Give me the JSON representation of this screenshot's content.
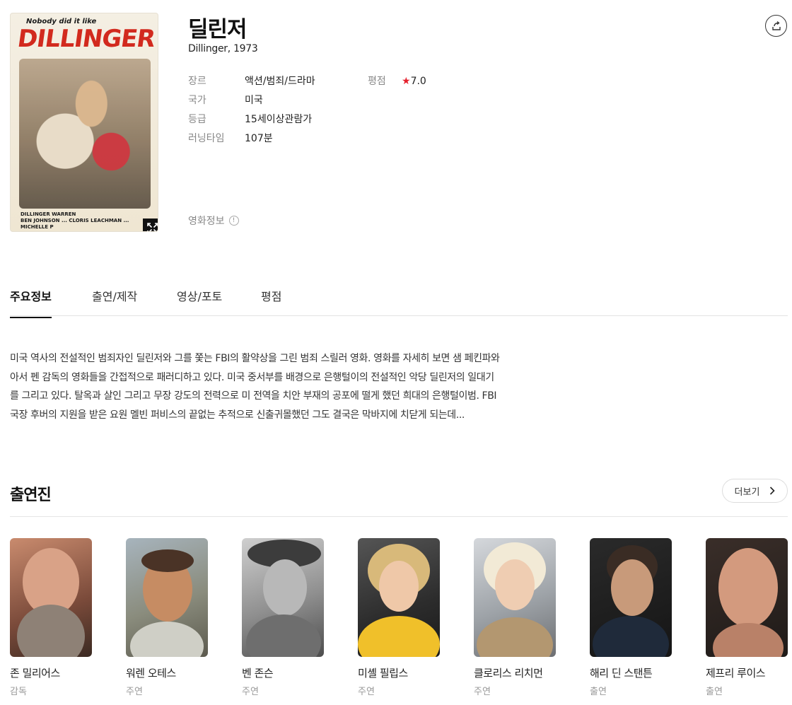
{
  "movie": {
    "poster": {
      "tagline": "Nobody did it like",
      "title": "DILLINGER",
      "credits_line1": "DILLINGER   WARREN",
      "credits_line2": "BEN JOHNSON ... CLORIS LEACHMAN ... MICHELLE P"
    },
    "title": "딜린저",
    "subtitle": "Dillinger, 1973",
    "info": [
      {
        "label": "장르",
        "value": "액션/범죄/드라마"
      },
      {
        "label": "국가",
        "value": "미국"
      },
      {
        "label": "등급",
        "value": "15세이상관람가"
      },
      {
        "label": "러닝타임",
        "value": "107분"
      }
    ],
    "rating": {
      "label": "평점",
      "value": "7.0",
      "star_color": "#e5202d"
    },
    "movie_info_label": "영화정보"
  },
  "tabs": [
    {
      "label": "주요정보",
      "active": true
    },
    {
      "label": "출연/제작",
      "active": false
    },
    {
      "label": "영상/포토",
      "active": false
    },
    {
      "label": "평점",
      "active": false
    }
  ],
  "synopsis": [
    "미국 역사의 전설적인 범죄자인 딜린저와 그를 쫓는 FBI의 활약상을 그린 범죄 스릴러 영화. 영화를 자세히 보면 샘 페킨파와",
    "아서 펜 감독의 영화들을 간접적으로 패러디하고 있다. 미국 중서부를 배경으로 은행털이의 전설적인 악당 딜린저의 일대기",
    "를 그리고 있다. 탈옥과 살인 그리고 무장 강도의 전력으로 미 전역을 치안 부재의 공포에 떨게 했던 희대의 은행털이범. FBI",
    "국장 후버의 지원을 받은 요원 멜빈 퍼비스의 끝없는 추적으로 신출귀몰했던 그도 결국은 막바지에 치닫게 되는데..."
  ],
  "cast_section": {
    "title": "출연진",
    "more_label": "더보기",
    "members": [
      {
        "name": "존 밀리어스",
        "role": "감독"
      },
      {
        "name": "워렌 오테스",
        "role": "주연"
      },
      {
        "name": "벤 존슨",
        "role": "주연"
      },
      {
        "name": "미셸 필립스",
        "role": "주연"
      },
      {
        "name": "클로리스 리치먼",
        "role": "주연"
      },
      {
        "name": "해리 딘 스탠튼",
        "role": "출연"
      },
      {
        "name": "제프리 루이스",
        "role": "출연"
      }
    ]
  }
}
